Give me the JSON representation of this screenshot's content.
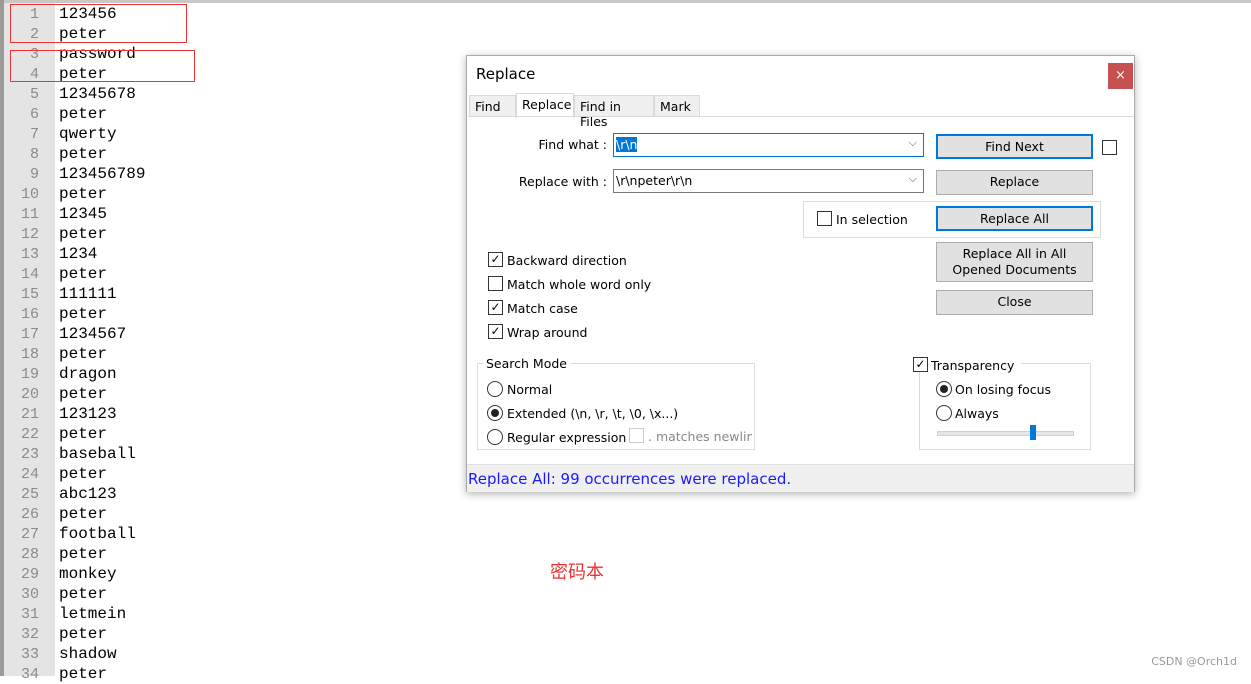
{
  "editor": {
    "lines": [
      "123456",
      "peter",
      "password",
      "peter",
      "12345678",
      "peter",
      "qwerty",
      "peter",
      "123456789",
      "peter",
      "12345",
      "peter",
      "1234",
      "peter",
      "111111",
      "peter",
      "1234567",
      "peter",
      "dragon",
      "peter",
      "123123",
      "peter",
      "baseball",
      "peter",
      "abc123",
      "peter",
      "football",
      "peter",
      "monkey",
      "peter",
      "letmein",
      "peter",
      "shadow",
      "peter"
    ]
  },
  "dialog": {
    "title": "Replace",
    "close": "×",
    "tabs": [
      "Find",
      "Replace",
      "Find in Files",
      "Mark"
    ],
    "active_tab": "Replace",
    "find_label": "Find what :",
    "find_value": "\\r\\n",
    "replace_label": "Replace with :",
    "replace_value": "\\r\\npeter\\r\\n",
    "buttons": {
      "find_next": "Find Next",
      "replace": "Replace",
      "replace_all": "Replace All",
      "replace_all_opened": "Replace All in All Opened Documents",
      "close": "Close"
    },
    "in_selection": {
      "label": "In selection",
      "checked": false
    },
    "options": [
      {
        "label": "Backward direction",
        "checked": true
      },
      {
        "label": "Match whole word only",
        "checked": false
      },
      {
        "label": "Match case",
        "checked": true
      },
      {
        "label": "Wrap around",
        "checked": true
      }
    ],
    "search_mode": {
      "title": "Search Mode",
      "options": [
        "Normal",
        "Extended (\\n, \\r, \\t, \\0, \\x...)",
        "Regular expression"
      ],
      "selected": "Extended (\\n, \\r, \\t, \\0, \\x...)",
      "matches_newline": ". matches newline"
    },
    "transparency": {
      "label": "Transparency",
      "checked": true,
      "options": [
        "On losing focus",
        "Always"
      ],
      "selected": "On losing focus",
      "level": 0.7
    },
    "status": "Replace All: 99 occurrences were replaced.",
    "status_color": "#1a1aff"
  },
  "annotation": "密码本",
  "watermark": "CSDN @Orch1d"
}
